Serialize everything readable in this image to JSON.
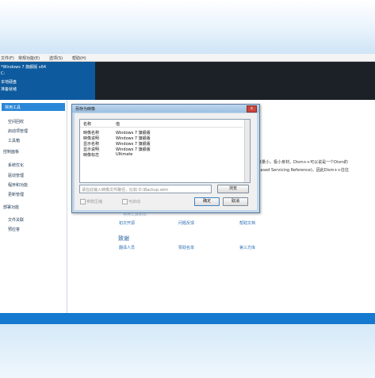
{
  "menubar": [
    "文件(F)",
    "常规功能(E)",
    "选项(S)",
    "帮助(H)"
  ],
  "header": {
    "title": "*Windows 7 旗舰版 x64",
    "line2": "C:",
    "line3": "本地硬盘",
    "line4": "准备就绪"
  },
  "sidebar": {
    "selected": "常用工具",
    "items": [
      {
        "label": "空间回收",
        "type": "item"
      },
      {
        "label": "启动项管理",
        "type": "item"
      },
      {
        "label": "工具箱",
        "type": "item"
      },
      {
        "label": "控制面板",
        "type": "header"
      },
      {
        "label": "系统优化",
        "type": "item"
      },
      {
        "label": "驱动管理",
        "type": "item"
      },
      {
        "label": "程序和功能",
        "type": "item"
      },
      {
        "label": "更新管理",
        "type": "item"
      },
      {
        "label": "部署功能",
        "type": "header"
      },
      {
        "label": "文件关联",
        "type": "item"
      },
      {
        "label": "预应答",
        "type": "item"
      }
    ]
  },
  "main": {
    "side_text_1": "体量小，极小身材。Dism++可以说是一个Dism的",
    "side_text_2": "Based Servicing Reference)，因此Dism++往往",
    "faint_section": "常用工具初识",
    "links_row1": [
      "初次开源",
      "问题反馈",
      "帮助文档"
    ],
    "section_title": "致谢",
    "links_row2": [
      "翻译人员",
      "赞助名单",
      "第三方库"
    ]
  },
  "dialog": {
    "title": "另存为映像",
    "close": "x",
    "columns": [
      "名称",
      "值"
    ],
    "rows": [
      {
        "name": "映像名称",
        "value": "Windows 7 旗舰版"
      },
      {
        "name": "映像说明",
        "value": "Windows 7 旗舰版"
      },
      {
        "name": "显示名称",
        "value": "Windows 7 旗舰版"
      },
      {
        "name": "显示说明",
        "value": "Windows 7 旗舰版"
      },
      {
        "name": "映像标志",
        "value": "Ultimate"
      }
    ],
    "path_placeholder": "请在此输入映像文件路径，比如 D:\\Backup.wim",
    "browse": "浏览",
    "opt1": "参数压缩",
    "opt2": "可启动",
    "ok": "确定",
    "cancel": "取消"
  }
}
